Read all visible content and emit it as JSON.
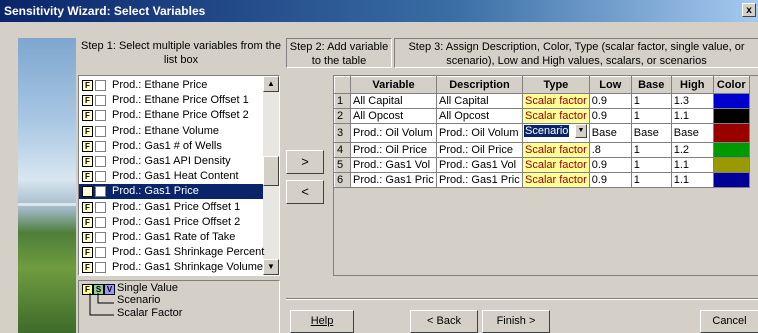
{
  "window": {
    "title": "Sensitivity Wizard: Select Variables",
    "close_glyph": "x"
  },
  "steps": {
    "step1": "Step 1: Select multiple variables from the list box",
    "step2": "Step 2: Add variable to the table",
    "step3": "Step 3: Assign Description, Color, Type (scalar factor, single value, or scenario), Low and High values, scalars, or scenarios"
  },
  "list": {
    "flag": "F",
    "items": [
      "Prod.: Ethane Price",
      "Prod.: Ethane Price Offset 1",
      "Prod.: Ethane Price Offset 2",
      "Prod.: Ethane Volume",
      "Prod.: Gas1 # of Wells",
      "Prod.: Gas1 API Density",
      "Prod.: Gas1 Heat Content",
      "Prod.: Gas1 Price",
      "Prod.: Gas1 Price Offset 1",
      "Prod.: Gas1 Price Offset 2",
      "Prod.: Gas1 Rate of Take",
      "Prod.: Gas1 Shrinkage Percent",
      "Prod.: Gas1 Shrinkage Volume"
    ],
    "selected_index": 7
  },
  "legend": {
    "icons": [
      "F",
      "S",
      "V"
    ],
    "single_value": "Single Value",
    "scenario": "Scenario",
    "scalar_factor": "Scalar Factor"
  },
  "buttons": {
    "add": ">",
    "remove": "<",
    "help": "Help",
    "back": "< Back",
    "finish": "Finish >",
    "cancel": "Cancel"
  },
  "table": {
    "headers": [
      "",
      "Variable",
      "Description",
      "Type",
      "Low",
      "Base",
      "High",
      "Color"
    ],
    "rows": [
      {
        "num": "1",
        "variable": "All Capital",
        "description": "All Capital",
        "type": "Scalar factor",
        "low": "0.9",
        "base": "1",
        "high": "1.3",
        "color": "#0000cc"
      },
      {
        "num": "2",
        "variable": "All Opcost",
        "description": "All Opcost",
        "type": "Scalar factor",
        "low": "0.9",
        "base": "1",
        "high": "1.1",
        "color": "#000000"
      },
      {
        "num": "3",
        "variable": "Prod.:   Oil Volum",
        "description": "Prod.:   Oil Volum",
        "type": "Scenario",
        "low": "Base",
        "base": "Base",
        "high": "Base",
        "color": "#990000"
      },
      {
        "num": "4",
        "variable": "Prod.:   Oil Price",
        "description": "Prod.:   Oil Price",
        "type": "Scalar factor",
        "low": ".8",
        "base": "1",
        "high": "1.2",
        "color": "#009900"
      },
      {
        "num": "5",
        "variable": "Prod.:   Gas1 Vol",
        "description": "Prod.:   Gas1 Vol",
        "type": "Scalar factor",
        "low": "0.9",
        "base": "1",
        "high": "1.1",
        "color": "#999900"
      },
      {
        "num": "6",
        "variable": "Prod.:   Gas1 Pric",
        "description": "Prod.:   Gas1 Pric",
        "type": "Scalar factor",
        "low": "0.9",
        "base": "1",
        "high": "1.1",
        "color": "#000099"
      }
    ],
    "editing_row": 2
  }
}
